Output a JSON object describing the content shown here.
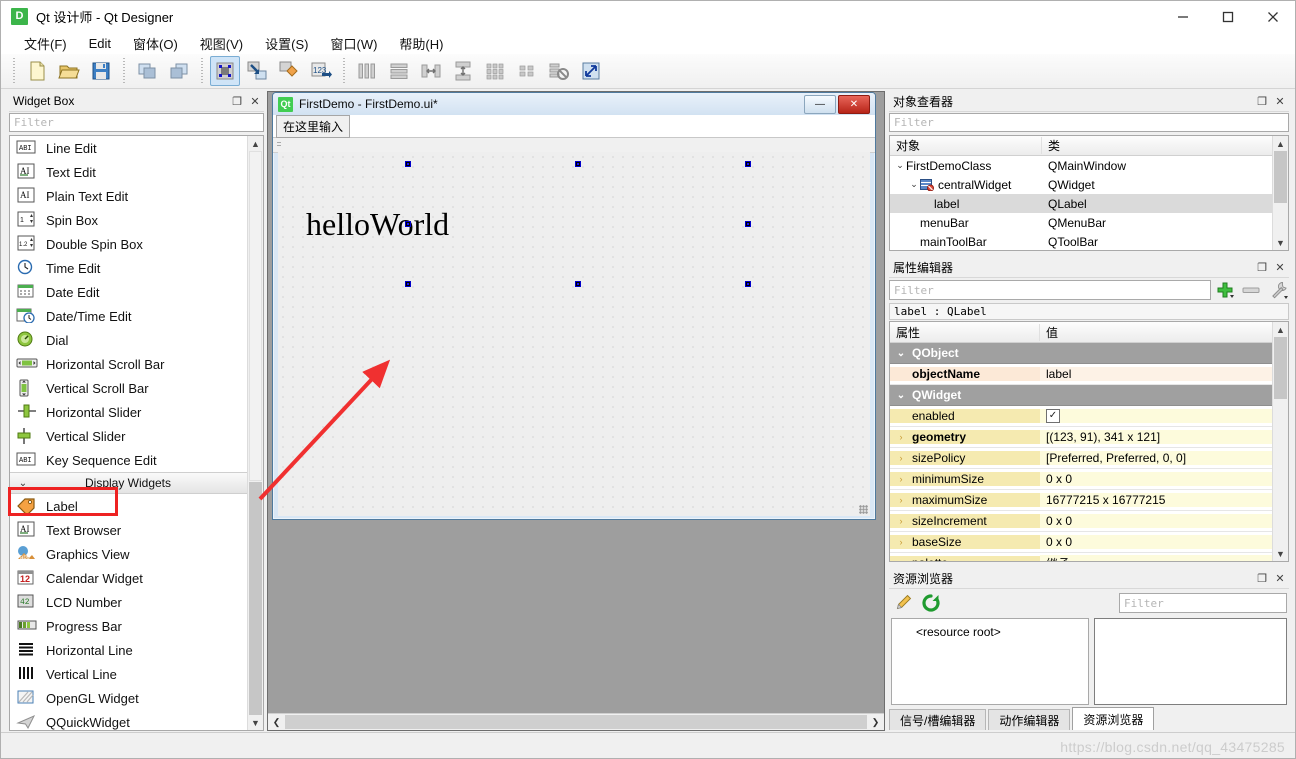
{
  "window": {
    "title": "Qt 设计师 - Qt Designer",
    "icon": "qt-designer-icon",
    "icon_letter": "D",
    "minimize": "−",
    "maximize": "□",
    "close": "✕"
  },
  "menubar": {
    "items": [
      {
        "label": "文件(F)",
        "name": "menu-file"
      },
      {
        "label": "Edit",
        "name": "menu-edit"
      },
      {
        "label": "窗体(O)",
        "name": "menu-form"
      },
      {
        "label": "视图(V)",
        "name": "menu-view"
      },
      {
        "label": "设置(S)",
        "name": "menu-settings"
      },
      {
        "label": "窗口(W)",
        "name": "menu-window"
      },
      {
        "label": "帮助(H)",
        "name": "menu-help"
      }
    ]
  },
  "toolbar": {
    "groups": [
      [
        "new-form-icon",
        "open-form-icon",
        "save-form-icon"
      ],
      [
        "undo-icon",
        "redo-icon"
      ],
      [
        "edit-widgets-icon",
        "edit-signals-slots-icon",
        "edit-buddies-icon",
        "edit-tab-order-icon"
      ],
      [
        "layout-horizontally-icon",
        "layout-vertically-icon",
        "layout-splitter-horizontal-icon",
        "layout-splitter-vertical-icon",
        "layout-grid-icon",
        "layout-form-icon",
        "break-layout-icon",
        "adjust-size-icon"
      ]
    ],
    "active_index": 0
  },
  "widget_box": {
    "title": "Widget Box",
    "float_btn": "❐",
    "close_btn": "✕",
    "filter_placeholder": "Filter",
    "items": [
      {
        "label": "Line Edit",
        "icon": "line-edit-icon",
        "type": "item"
      },
      {
        "label": "Text Edit",
        "icon": "text-edit-icon",
        "type": "item"
      },
      {
        "label": "Plain Text Edit",
        "icon": "plain-text-edit-icon",
        "type": "item"
      },
      {
        "label": "Spin Box",
        "icon": "spin-box-icon",
        "type": "item"
      },
      {
        "label": "Double Spin Box",
        "icon": "double-spin-box-icon",
        "type": "item"
      },
      {
        "label": "Time Edit",
        "icon": "time-edit-icon",
        "type": "item"
      },
      {
        "label": "Date Edit",
        "icon": "date-edit-icon",
        "type": "item"
      },
      {
        "label": "Date/Time Edit",
        "icon": "date-time-edit-icon",
        "type": "item"
      },
      {
        "label": "Dial",
        "icon": "dial-icon",
        "type": "item"
      },
      {
        "label": "Horizontal Scroll Bar",
        "icon": "horizontal-scroll-bar-icon",
        "type": "item"
      },
      {
        "label": "Vertical Scroll Bar",
        "icon": "vertical-scroll-bar-icon",
        "type": "item"
      },
      {
        "label": "Horizontal Slider",
        "icon": "horizontal-slider-icon",
        "type": "item"
      },
      {
        "label": "Vertical Slider",
        "icon": "vertical-slider-icon",
        "type": "item"
      },
      {
        "label": "Key Sequence Edit",
        "icon": "key-sequence-edit-icon",
        "type": "item"
      },
      {
        "label": "Display Widgets",
        "icon": "chevron-down-icon",
        "type": "category"
      },
      {
        "label": "Label",
        "icon": "label-icon",
        "type": "item",
        "highlighted": true
      },
      {
        "label": "Text Browser",
        "icon": "text-browser-icon",
        "type": "item"
      },
      {
        "label": "Graphics View",
        "icon": "graphics-view-icon",
        "type": "item"
      },
      {
        "label": "Calendar Widget",
        "icon": "calendar-widget-icon",
        "type": "item"
      },
      {
        "label": "LCD Number",
        "icon": "lcd-number-icon",
        "type": "item"
      },
      {
        "label": "Progress Bar",
        "icon": "progress-bar-icon",
        "type": "item"
      },
      {
        "label": "Horizontal Line",
        "icon": "horizontal-line-icon",
        "type": "item"
      },
      {
        "label": "Vertical Line",
        "icon": "vertical-line-icon",
        "type": "item"
      },
      {
        "label": "OpenGL Widget",
        "icon": "opengl-widget-icon",
        "type": "item"
      },
      {
        "label": "QQuickWidget",
        "icon": "qquickwidget-icon",
        "type": "item"
      }
    ]
  },
  "form": {
    "title": "FirstDemo - FirstDemo.ui*",
    "badge": "Qt",
    "minimize": "—",
    "close": "✕",
    "menu_placeholder": "在这里输入",
    "label_text": "helloWorld"
  },
  "object_inspector": {
    "title": "对象查看器",
    "float_btn": "❐",
    "close_btn": "✕",
    "filter_placeholder": "Filter",
    "columns": [
      "对象",
      "类"
    ],
    "rows": [
      {
        "object": "FirstDemoClass",
        "class": "QMainWindow",
        "indent": 0,
        "chevron": "⌄",
        "selected": false,
        "icon": ""
      },
      {
        "object": "centralWidget",
        "class": "QWidget",
        "indent": 1,
        "chevron": "⌄",
        "selected": false,
        "icon": "central-widget-icon"
      },
      {
        "object": "label",
        "class": "QLabel",
        "indent": 2,
        "chevron": "",
        "selected": true,
        "icon": ""
      },
      {
        "object": "menuBar",
        "class": "QMenuBar",
        "indent": 1,
        "chevron": "",
        "selected": false,
        "icon": ""
      },
      {
        "object": "mainToolBar",
        "class": "QToolBar",
        "indent": 1,
        "chevron": "",
        "selected": false,
        "icon": ""
      }
    ]
  },
  "property_editor": {
    "title": "属性编辑器",
    "float_btn": "❐",
    "close_btn": "✕",
    "filter_placeholder": "Filter",
    "add_button": "add-dynamic-property-icon",
    "remove_button": "remove-dynamic-property-icon",
    "config_button": "configure-icon",
    "object_line": "label : QLabel",
    "columns": [
      "属性",
      "值"
    ],
    "rows": [
      {
        "name": "QObject",
        "value": "",
        "kind": "group",
        "chevron": "⌄",
        "bold": true
      },
      {
        "name": "objectName",
        "value": "label",
        "kind": "highlight",
        "chevron": "",
        "bold": true
      },
      {
        "name": "QWidget",
        "value": "",
        "kind": "group",
        "chevron": "⌄",
        "bold": true
      },
      {
        "name": "enabled",
        "value": "",
        "kind": "yellow",
        "chevron": "",
        "bold": false,
        "checkbox": true,
        "checked": true
      },
      {
        "name": "geometry",
        "value": "[(123, 91), 341 x 121]",
        "kind": "yellow",
        "chevron": "›",
        "bold": true
      },
      {
        "name": "sizePolicy",
        "value": "[Preferred, Preferred, 0, 0]",
        "kind": "yellow",
        "chevron": "›",
        "bold": false
      },
      {
        "name": "minimumSize",
        "value": "0 x 0",
        "kind": "yellow",
        "chevron": "›",
        "bold": false
      },
      {
        "name": "maximumSize",
        "value": "16777215 x 16777215",
        "kind": "yellow",
        "chevron": "›",
        "bold": false
      },
      {
        "name": "sizeIncrement",
        "value": "0 x 0",
        "kind": "yellow",
        "chevron": "›",
        "bold": false
      },
      {
        "name": "baseSize",
        "value": "0 x 0",
        "kind": "yellow",
        "chevron": "›",
        "bold": false
      },
      {
        "name": "palette",
        "value": "继承",
        "kind": "yellow",
        "chevron": "›",
        "bold": false
      }
    ]
  },
  "resource_browser": {
    "title": "资源浏览器",
    "float_btn": "❐",
    "close_btn": "✕",
    "edit_icon": "pencil-edit-icon",
    "reload_icon": "reload-icon",
    "filter_placeholder": "Filter",
    "root_label": "<resource root>",
    "tabs": [
      {
        "label": "信号/槽编辑器",
        "active": false
      },
      {
        "label": "动作编辑器",
        "active": false
      },
      {
        "label": "资源浏览器",
        "active": true
      }
    ]
  },
  "watermark": "https://blog.csdn.net/qq_43475285",
  "colors": {
    "accent_blue": "#cfe4f7",
    "annotation_red": "#ee2222",
    "selection_gray": "#dadada",
    "group_gray": "#a0a0a0",
    "property_yellow": "#fdfbdc",
    "property_orange": "#fdf2e6",
    "qt_green": "#41cd52"
  }
}
